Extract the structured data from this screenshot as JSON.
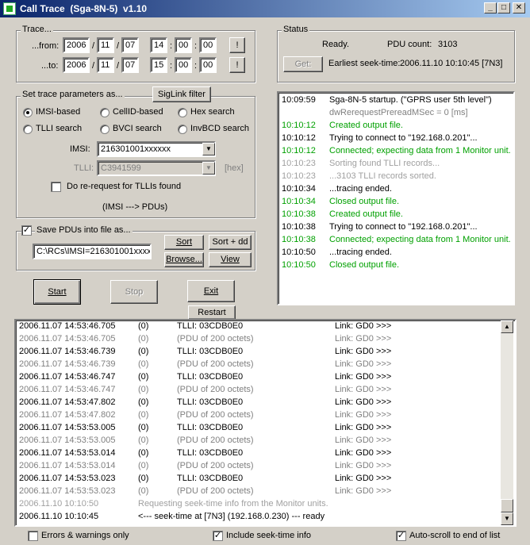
{
  "window": {
    "title": "Call Trace  (Sga-8N-5)  v1.10",
    "min_glyph": "_",
    "max_glyph": "□",
    "close_glyph": "✕"
  },
  "trace": {
    "label": "Trace...",
    "from_label": "...from:",
    "to_label": "...to:",
    "from": {
      "year": "2006",
      "month": "11",
      "day": "07",
      "hour": "14",
      "min": "00",
      "sec": "00"
    },
    "to": {
      "year": "2006",
      "month": "11",
      "day": "07",
      "hour": "15",
      "min": "00",
      "sec": "00"
    },
    "date_sep": "/",
    "time_sep": ":",
    "excl_label": "!"
  },
  "status": {
    "label": "Status",
    "state": "Ready.",
    "pdu_count_label": "PDU count:",
    "pdu_count": "3103",
    "get_label": "Get:",
    "seek_label": "Earliest seek-time:",
    "seek_value": "2006.11.10 10:10:45  [7N3]"
  },
  "params": {
    "label": "Set trace parameters as...",
    "siglink_label": "SigLink filter",
    "radios": {
      "imsi": "IMSI-based",
      "cellid": "CellID-based",
      "hex": "Hex search",
      "tlli": "TLLI search",
      "bvci": "BVCI search",
      "invbcd": "InvBCD search"
    },
    "imsi_label": "IMSI:",
    "imsi_value": "216301001xxxxxx",
    "tlli_label": "TLLI:",
    "tlli_value": "C3941599",
    "hex_note": "[hex]",
    "rerequest_label": "Do re-request for TLLIs found",
    "mapping": "(IMSI  --->  PDUs)"
  },
  "save": {
    "label": "Save PDUs into file as...",
    "checked": true,
    "file_value": "C:\\RCs\\IMSI=216301001xxxx",
    "sort": "Sort",
    "sort_add": "Sort + dd",
    "browse": "Browse...",
    "view": "View"
  },
  "actions": {
    "start": "Start",
    "stop": "Stop",
    "exit": "Exit",
    "restart": "Restart"
  },
  "log": [
    {
      "time": "10:09:59",
      "msg": "Sga-8N-5 startup.  (\"GPRS user 5th level\")",
      "color": "#000000"
    },
    {
      "time": "",
      "msg": "dwRerequestPrereadMSec = 0 [ms]",
      "color": "#808080"
    },
    {
      "time": "10:10:12",
      "msg": "Created output file.",
      "color": "#00a000"
    },
    {
      "time": "10:10:12",
      "msg": "Trying to connect to \"192.168.0.201\"...",
      "color": "#000000"
    },
    {
      "time": "10:10:12",
      "msg": "Connected; expecting data from 1 Monitor unit.",
      "color": "#00a000"
    },
    {
      "time": "10:10:23",
      "msg": "Sorting found TLLI records...",
      "color": "#a0a0a0"
    },
    {
      "time": "10:10:23",
      "msg": "...3103 TLLI records sorted.",
      "color": "#a0a0a0"
    },
    {
      "time": "10:10:34",
      "msg": "...tracing ended.",
      "color": "#000000"
    },
    {
      "time": "10:10:34",
      "msg": "Closed output file.",
      "color": "#00a000"
    },
    {
      "time": "10:10:38",
      "msg": "Created output file.",
      "color": "#00a000"
    },
    {
      "time": "10:10:38",
      "msg": "Trying to connect to \"192.168.0.201\"...",
      "color": "#000000"
    },
    {
      "time": "10:10:38",
      "msg": "Connected; expecting data from 1 Monitor unit.",
      "color": "#00a000"
    },
    {
      "time": "10:10:50",
      "msg": "...tracing ended.",
      "color": "#000000"
    },
    {
      "time": "10:10:50",
      "msg": "Closed output file.",
      "color": "#00a000"
    }
  ],
  "trace_rows": [
    {
      "ts": "2006.11.07 14:53:46.705",
      "n": "(0)",
      "info": "TLLI: 03CDB0E0",
      "link": "Link: GD0 >>>",
      "gray": false
    },
    {
      "ts": "2006.11.07 14:53:46.705",
      "n": "(0)",
      "info": "(PDU of 200 octets)",
      "link": "Link: GD0 >>>",
      "gray": true
    },
    {
      "ts": "2006.11.07 14:53:46.739",
      "n": "(0)",
      "info": "TLLI: 03CDB0E0",
      "link": "Link: GD0 >>>",
      "gray": false
    },
    {
      "ts": "2006.11.07 14:53:46.739",
      "n": "(0)",
      "info": "(PDU of 200 octets)",
      "link": "Link: GD0 >>>",
      "gray": true
    },
    {
      "ts": "2006.11.07 14:53:46.747",
      "n": "(0)",
      "info": "TLLI: 03CDB0E0",
      "link": "Link: GD0 >>>",
      "gray": false
    },
    {
      "ts": "2006.11.07 14:53:46.747",
      "n": "(0)",
      "info": "(PDU of 200 octets)",
      "link": "Link: GD0 >>>",
      "gray": true
    },
    {
      "ts": "2006.11.07 14:53:47.802",
      "n": "(0)",
      "info": "TLLI: 03CDB0E0",
      "link": "Link: GD0 >>>",
      "gray": false
    },
    {
      "ts": "2006.11.07 14:53:47.802",
      "n": "(0)",
      "info": "(PDU of 200 octets)",
      "link": "Link: GD0 >>>",
      "gray": true
    },
    {
      "ts": "2006.11.07 14:53:53.005",
      "n": "(0)",
      "info": "TLLI: 03CDB0E0",
      "link": "Link: GD0 >>>",
      "gray": false
    },
    {
      "ts": "2006.11.07 14:53:53.005",
      "n": "(0)",
      "info": "(PDU of 200 octets)",
      "link": "Link: GD0 >>>",
      "gray": true
    },
    {
      "ts": "2006.11.07 14:53:53.014",
      "n": "(0)",
      "info": "TLLI: 03CDB0E0",
      "link": "Link: GD0 >>>",
      "gray": false
    },
    {
      "ts": "2006.11.07 14:53:53.014",
      "n": "(0)",
      "info": "(PDU of 200 octets)",
      "link": "Link: GD0 >>>",
      "gray": true
    },
    {
      "ts": "2006.11.07 14:53:53.023",
      "n": "(0)",
      "info": "TLLI: 03CDB0E0",
      "link": "Link: GD0 >>>",
      "gray": false
    },
    {
      "ts": "2006.11.07 14:53:53.023",
      "n": "(0)",
      "info": "(PDU of 200 octets)",
      "link": "Link: GD0 >>>",
      "gray": true
    }
  ],
  "trace_notes": [
    {
      "ts": "2006.11.10 10:10:50",
      "text": "Requesting seek-time info from the Monitor units.",
      "gray": true
    },
    {
      "ts": "2006.11.10 10:10:45",
      "text": "<--- seek-time at [7N3] (192.168.0.230) --- ready",
      "gray": false
    }
  ],
  "bottom": {
    "errors_only": "Errors & warnings only",
    "include_seek": "Include seek-time info",
    "autoscroll": "Auto-scroll to end of list",
    "check_glyph": "✓"
  },
  "colors": {
    "gray_text": "#808080",
    "green_text": "#00a000",
    "title_start": "#0a246a",
    "title_end": "#a6caf0"
  }
}
